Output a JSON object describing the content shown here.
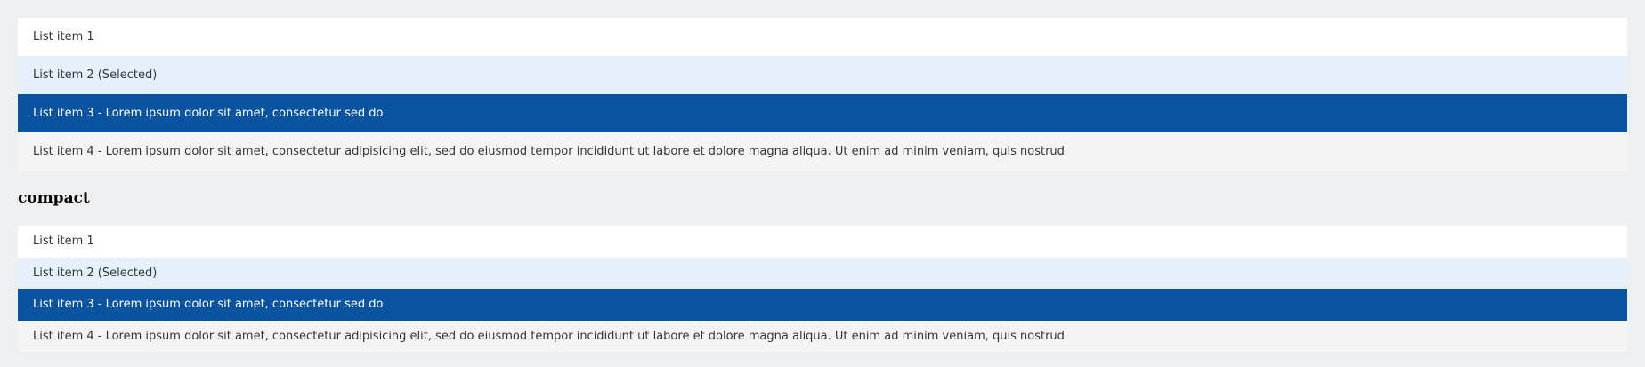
{
  "lists": {
    "standard": {
      "items": [
        {
          "label": "List item 1",
          "state": "default"
        },
        {
          "label": "List item 2 (Selected)",
          "state": "selected"
        },
        {
          "label": "List item 3 - Lorem ipsum dolor sit amet, consectetur sed do",
          "state": "active"
        },
        {
          "label": "List item 4 - Lorem ipsum dolor sit amet, consectetur adipisicing elit, sed do eiusmod tempor incididunt ut labore et dolore magna aliqua. Ut enim ad minim veniam, quis nostrud",
          "state": "hover"
        }
      ]
    },
    "compact": {
      "title": "compact",
      "items": [
        {
          "label": "List item 1",
          "state": "default"
        },
        {
          "label": "List item 2 (Selected)",
          "state": "selected"
        },
        {
          "label": "List item 3 - Lorem ipsum dolor sit amet, consectetur sed do",
          "state": "active"
        },
        {
          "label": "List item 4 - Lorem ipsum dolor sit amet, consectetur adipisicing elit, sed do eiusmod tempor incididunt ut labore et dolore magna aliqua. Ut enim ad minim veniam, quis nostrud",
          "state": "hover"
        }
      ]
    }
  },
  "colors": {
    "page_background": "#edeff0",
    "item_default": "#ffffff",
    "item_selected": "#e5f0fa",
    "item_active": "#0854a0",
    "item_hover": "#f4f4f4",
    "text": "#32363a",
    "text_active": "#ffffff"
  }
}
